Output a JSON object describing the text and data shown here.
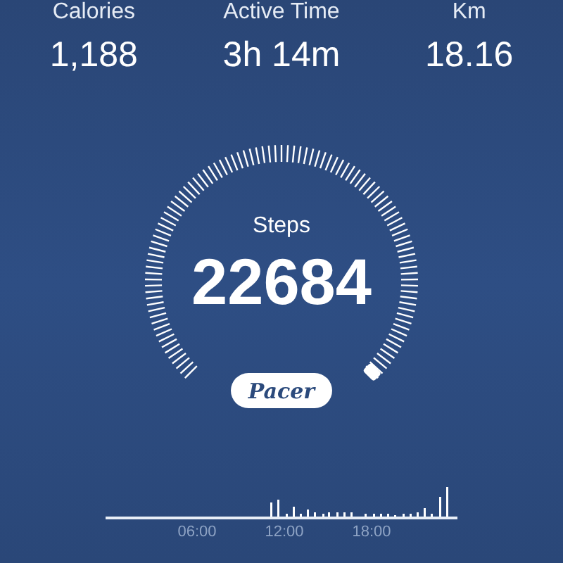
{
  "stats": [
    {
      "label": "Calories",
      "value": "1,188"
    },
    {
      "label": "Active Time",
      "value": "3h 14m"
    },
    {
      "label": "Km",
      "value": "18.16"
    }
  ],
  "gauge": {
    "label": "Steps",
    "value": "22684"
  },
  "brand_button": {
    "label": "Pacer"
  },
  "activity_chart": {
    "time_labels": [
      "06:00",
      "12:00",
      "18:00"
    ]
  }
}
